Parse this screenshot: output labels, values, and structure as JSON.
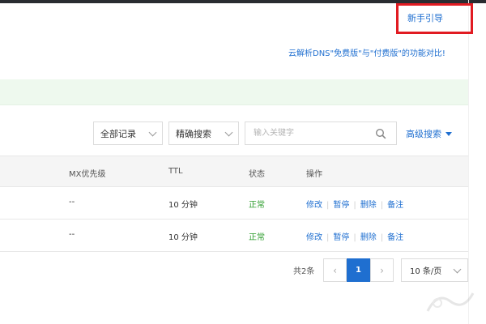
{
  "header": {
    "guide_link": "新手引导",
    "compare_link": "云解析DNS\"免费版\"与\"付费版\"的功能对比!"
  },
  "toolbar": {
    "record_filter": "全部记录",
    "search_mode": "精确搜索",
    "search_placeholder": "输入关键字",
    "advanced_search": "高级搜索"
  },
  "table": {
    "columns": [
      "MX优先级",
      "TTL",
      "状态",
      "操作"
    ],
    "rows": [
      {
        "mx": "--",
        "ttl": "10 分钟",
        "status": "正常",
        "actions": [
          "修改",
          "暂停",
          "删除",
          "备注"
        ]
      },
      {
        "mx": "--",
        "ttl": "10 分钟",
        "status": "正常",
        "actions": [
          "修改",
          "暂停",
          "删除",
          "备注"
        ]
      }
    ]
  },
  "pagination": {
    "total": "共2条",
    "current_page": "1",
    "page_size": "10 条/页"
  },
  "colors": {
    "link": "#1f6fd0",
    "status_ok": "#2e9d2e",
    "notice_bg": "#eef9ee",
    "highlight_box": "#e11b22"
  },
  "icons": {
    "search": "search-icon",
    "dropdown": "chevron-down-icon",
    "prev": "chevron-left-icon",
    "next": "chevron-right-icon"
  }
}
